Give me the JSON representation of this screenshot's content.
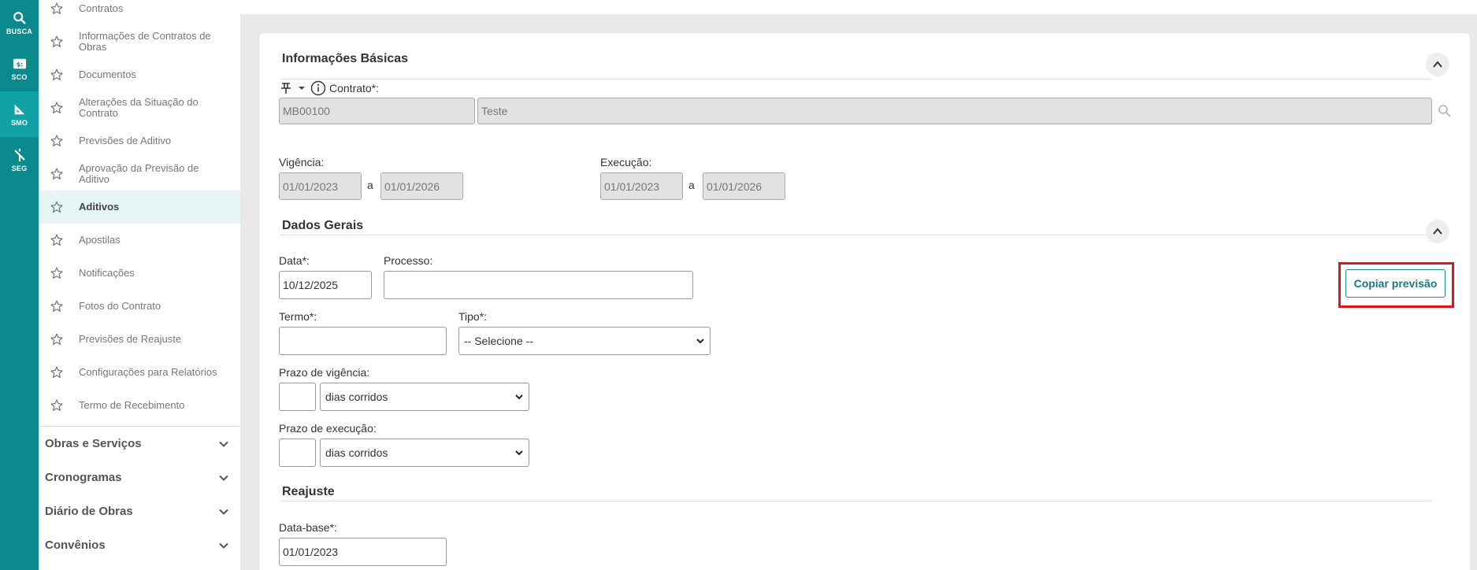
{
  "rail": [
    {
      "label": "BUSCA",
      "icon": "search-icon"
    },
    {
      "label": "SCO",
      "icon": "sco-icon"
    },
    {
      "label": "SMO",
      "icon": "ruler-icon"
    },
    {
      "label": "SEG",
      "icon": "split-icon"
    }
  ],
  "sidebar": {
    "items": [
      {
        "label": "Contratos"
      },
      {
        "label": "Informações de Contratos de Obras"
      },
      {
        "label": "Documentos"
      },
      {
        "label": "Alterações da Situação do Contrato"
      },
      {
        "label": "Previsões de Aditivo"
      },
      {
        "label": "Aprovação da Previsão de Aditivo"
      },
      {
        "label": "Aditivos"
      },
      {
        "label": "Apostilas"
      },
      {
        "label": "Notificações"
      },
      {
        "label": "Fotos do Contrato"
      },
      {
        "label": "Previsões de Reajuste"
      },
      {
        "label": "Configurações para Relatórios"
      },
      {
        "label": "Termo de Recebimento"
      }
    ],
    "sections": [
      {
        "label": "Obras e Serviços"
      },
      {
        "label": "Cronogramas"
      },
      {
        "label": "Diário de Obras"
      },
      {
        "label": "Convênios"
      }
    ]
  },
  "basic": {
    "title": "Informações Básicas",
    "contrato_label": "Contrato*:",
    "contrato_code": "MB00100",
    "contrato_name": "Teste",
    "vigencia_label": "Vigência:",
    "vigencia_start": "01/01/2023",
    "vigencia_end": "01/01/2026",
    "execucao_label": "Execução:",
    "execucao_start": "01/01/2023",
    "execucao_end": "01/01/2026",
    "range_sep": "a"
  },
  "general": {
    "title": "Dados Gerais",
    "data_label": "Data*:",
    "data_value": "10/12/2025",
    "processo_label": "Processo:",
    "processo_value": "",
    "copy_button": "Copiar previsão",
    "termo_label": "Termo*:",
    "termo_value": "",
    "tipo_label": "Tipo*:",
    "tipo_value": "-- Selecione --",
    "prazo_vig_label": "Prazo de vigência:",
    "prazo_vig_unit": "dias corridos",
    "prazo_exec_label": "Prazo de execução:",
    "prazo_exec_unit": "dias corridos"
  },
  "reajuste": {
    "title": "Reajuste",
    "database_label": "Data-base*:",
    "database_value": "01/01/2023"
  },
  "colors": {
    "rail": "#0b8a8e",
    "accent": "#1a8c92",
    "highlight": "#e0141b"
  }
}
